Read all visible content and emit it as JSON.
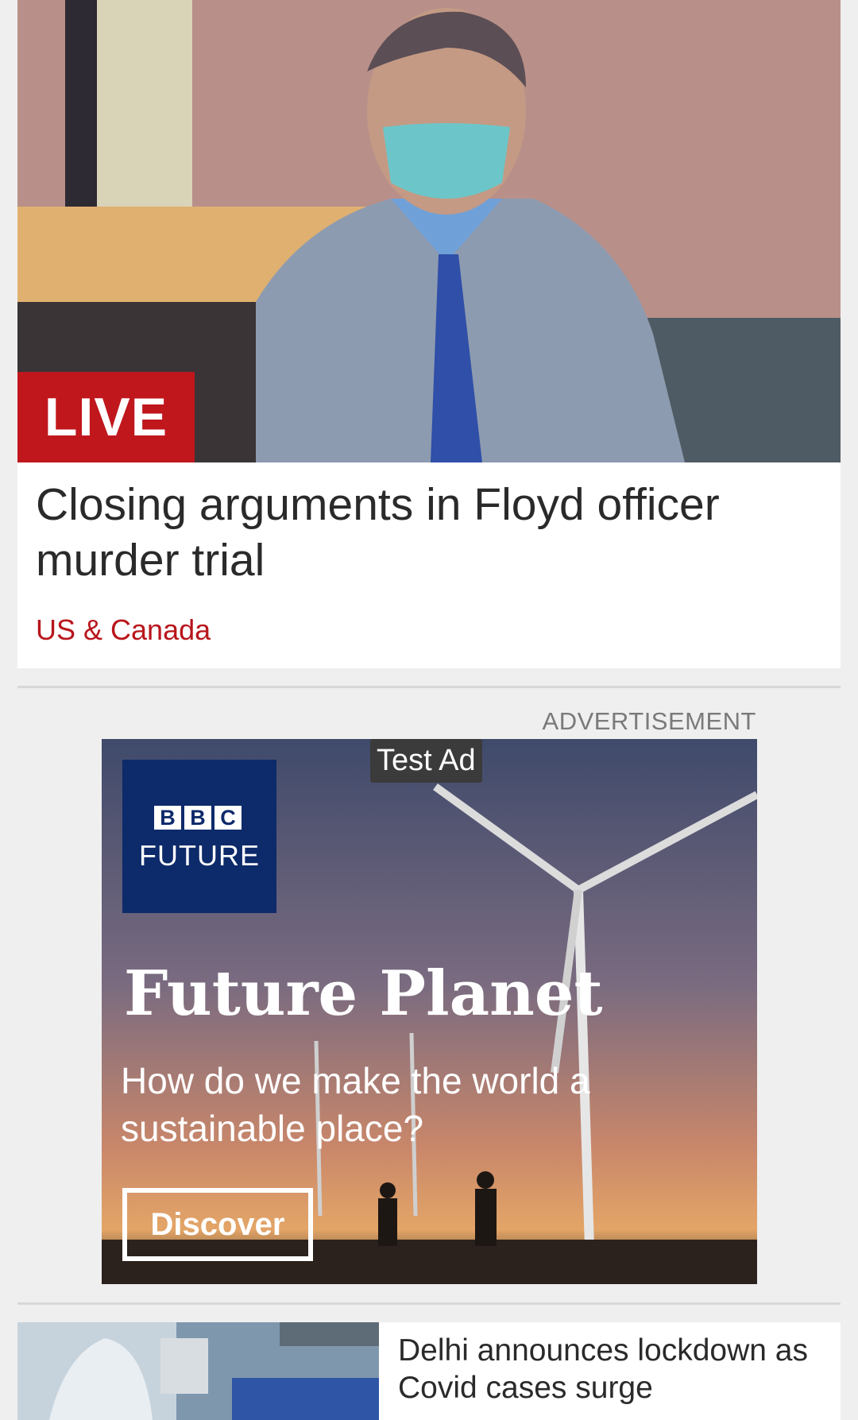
{
  "hero": {
    "badge": "LIVE",
    "title": "Closing arguments in Floyd officer murder trial",
    "section": "US & Canada"
  },
  "ad": {
    "label": "ADVERTISEMENT",
    "test_tag": "Test Ad",
    "brand_blocks": [
      "B",
      "B",
      "C"
    ],
    "brand_sub": "FUTURE",
    "headline": "Future Planet",
    "subtext": "How do we make the world a sustainable place?",
    "cta": "Discover"
  },
  "story2": {
    "title": "Delhi announces lockdown as Covid cases surge"
  },
  "colors": {
    "live_red": "#c0171d",
    "section_red": "#b8151b",
    "bbc_blue": "#0d2a6a"
  }
}
